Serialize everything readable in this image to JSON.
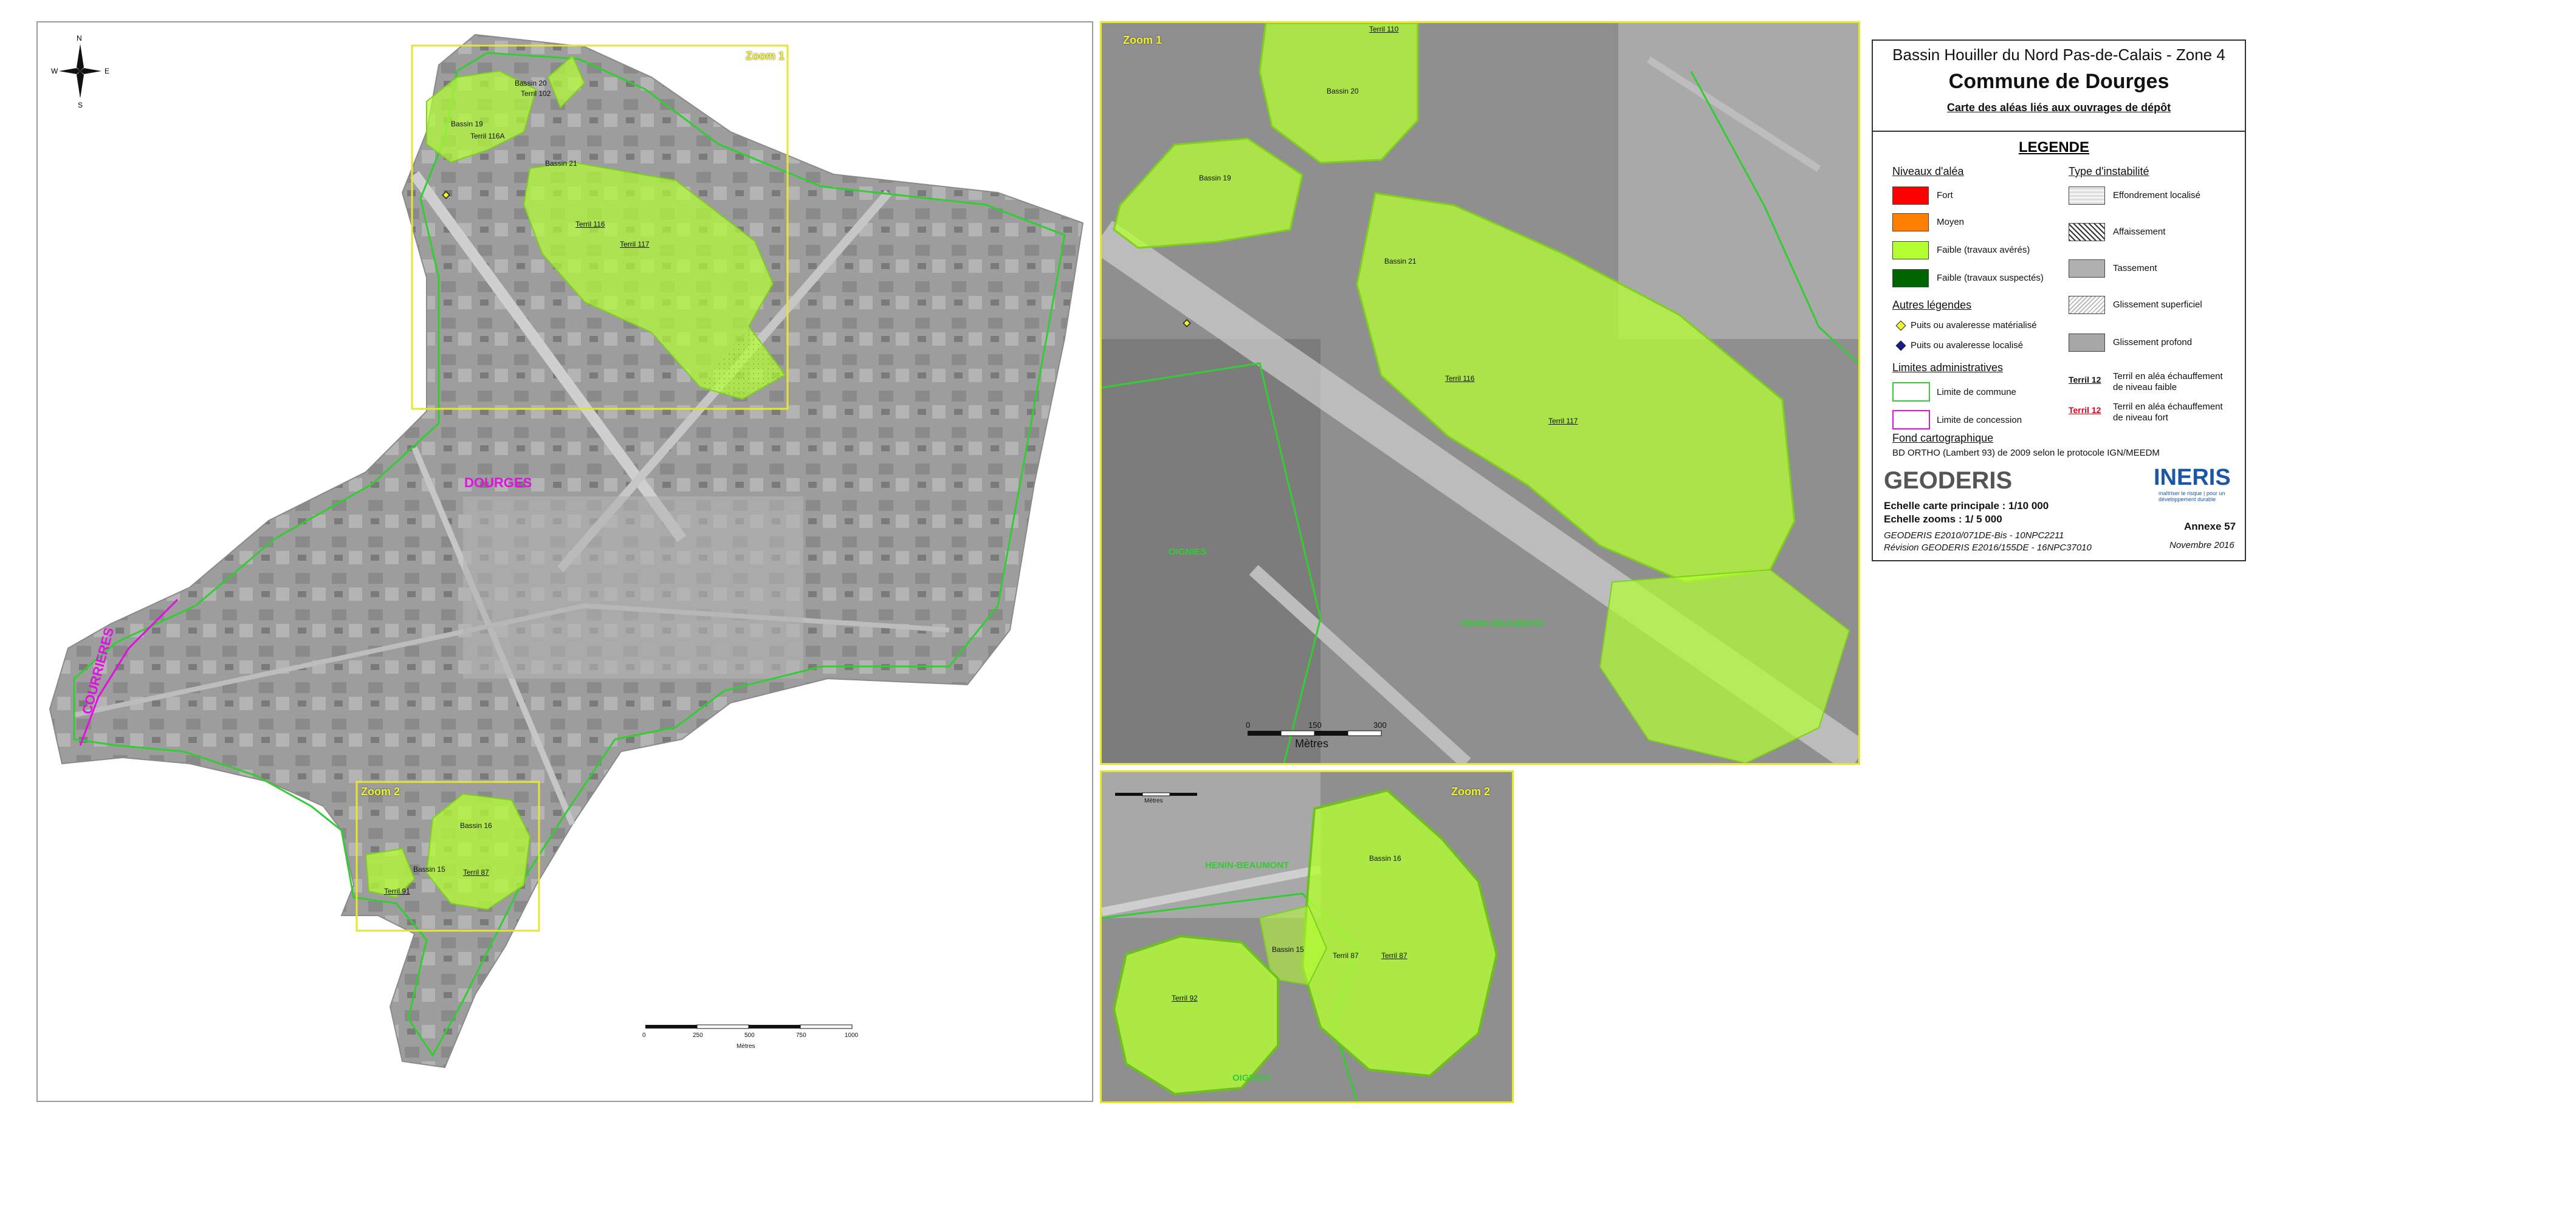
{
  "colors": {
    "fort": "#ff0000",
    "moyen": "#ff8000",
    "faible_averes": "#b4ff32",
    "faible_suspectes": "#006400",
    "commune_line": "#33cc33",
    "concession_line": "#e010e0",
    "zoom_frame": "#e6e62e"
  },
  "main_map": {
    "zoom1_label": "Zoom 1",
    "zoom2_label": "Zoom 2",
    "commune_label": "DOURGES",
    "neighbor_label": "COURRIERES",
    "features": {
      "bassin20": "Bassin 20",
      "terril102": "Terril 102",
      "bassin19": "Bassin 19",
      "terril116a": "Terril 116A",
      "bassin21": "Bassin 21",
      "terril116": "Terril 116",
      "terril117": "Terril 117",
      "bassin16": "Bassin 16",
      "bassin15": "Bassin 15",
      "terril87": "Terril 87",
      "terril91": "Terril 91"
    },
    "scale": {
      "ticks": [
        "0",
        "250",
        "500",
        "750",
        "1000"
      ],
      "unit": "Mètres"
    },
    "north_icon": "north-arrow-icon"
  },
  "zoom1_map": {
    "title": "Zoom 1",
    "features": {
      "terril110": "Terril 110",
      "bassin20": "Bassin 20",
      "bassin19": "Bassin 19",
      "bassin21": "Bassin 21",
      "terril116": "Terril 116",
      "terril117": "Terril 117"
    },
    "neighbors": {
      "west": "OIGNIES",
      "south": "HENIN-BEAUMONT"
    },
    "scale": {
      "ticks": [
        "0",
        "150",
        "300"
      ],
      "unit": "Mètres"
    }
  },
  "zoom2_map": {
    "title": "Zoom 2",
    "features": {
      "bassin16": "Bassin 16",
      "bassin15": "Bassin 15",
      "terril87a": "Terril 87",
      "terril87b": "Terril 87",
      "terril92": "Terril 92"
    },
    "neighbors": {
      "north": "HENIN-BEAUMONT",
      "south": "OIGNIES"
    },
    "scale": {
      "unit": "Mètres"
    }
  },
  "legend": {
    "title1": "Bassin Houiller du Nord Pas-de-Calais - Zone 4",
    "title2": "Commune de Dourges",
    "title3": "Carte des aléas liés aux ouvrages de dépôt",
    "heading": "LEGENDE",
    "niveaux_title": "Niveaux d'aléa",
    "niveaux": [
      "Fort",
      "Moyen",
      "Faible (travaux avérés)",
      "Faible (travaux suspectés)"
    ],
    "instab_title": "Type d'instabilité",
    "instab": [
      "Effondrement  localisé",
      "Affaissement",
      "Tassement",
      "Glissement superficiel",
      "Glissement profond"
    ],
    "autres_title": "Autres légendes",
    "autres": [
      "Puits ou avaleresse matérialisé",
      "Puits ou avaleresse localisé"
    ],
    "limites_title": "Limites administratives",
    "limites": [
      "Limite de commune",
      "Limite de concession"
    ],
    "terril_sample": "Terril 12",
    "terril_faible": [
      "Terril en aléa échauffement",
      "de niveau faible"
    ],
    "terril_fort": [
      "Terril en aléa échauffement",
      "de niveau fort"
    ],
    "fond_title": "Fond cartographique",
    "fond_text": "BD ORTHO (Lambert 93) de 2009 selon le protocole IGN/MEEDM",
    "logo_geoderis": "GEODERIS",
    "logo_ineris": "INERIS",
    "ineris_tag": "maîtriser le risque | pour un développement durable",
    "echelle_principale": "Echelle carte principale : 1/10 000",
    "echelle_zooms": "Echelle zooms : 1/ 5 000",
    "ref1": "GEODERIS E2010/071DE-Bis - 10NPC2211",
    "ref2": "Révision GEODERIS E2016/155DE - 16NPC37010",
    "annexe": "Annexe 57",
    "date": "Novembre 2016"
  }
}
